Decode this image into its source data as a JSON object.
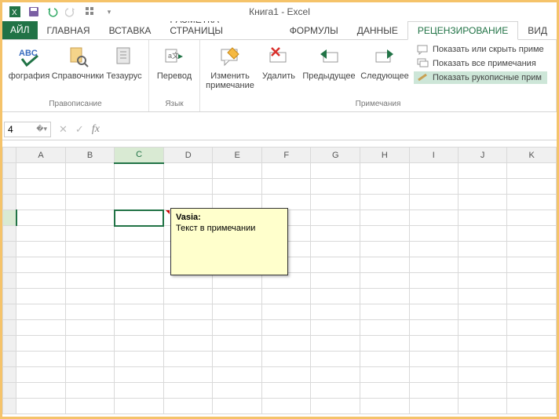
{
  "title": "Книга1 - Excel",
  "qat": {
    "save": "save",
    "undo": "undo",
    "redo": "redo",
    "touch": "touch",
    "custom": "custom"
  },
  "tabs": {
    "file": "АЙЛ",
    "home": "ГЛАВНАЯ",
    "insert": "ВСТАВКА",
    "pagelayout": "РАЗМЕТКА СТРАНИЦЫ",
    "formulas": "ФОРМУЛЫ",
    "data": "ДАННЫЕ",
    "review": "РЕЦЕНЗИРОВАНИЕ",
    "view": "ВИД"
  },
  "ribbon": {
    "proofing": {
      "label": "Правописание",
      "spelling": "фография",
      "research": "Справочники",
      "thesaurus": "Тезаурус"
    },
    "language": {
      "label": "Язык",
      "translate": "Перевод"
    },
    "comments": {
      "label": "Примечания",
      "edit": "Изменить примечание",
      "delete": "Удалить",
      "prev": "Предыдущее",
      "next": "Следующее",
      "showhide": "Показать или скрыть приме",
      "showall": "Показать все примечания",
      "showink": "Показать рукописные прим"
    }
  },
  "namebox": "4",
  "columns": [
    "A",
    "B",
    "C",
    "D",
    "E",
    "F",
    "G",
    "H",
    "I",
    "J",
    "K"
  ],
  "active_col": "C",
  "comment": {
    "author": "Vasia:",
    "text": "Текст в примечании"
  }
}
